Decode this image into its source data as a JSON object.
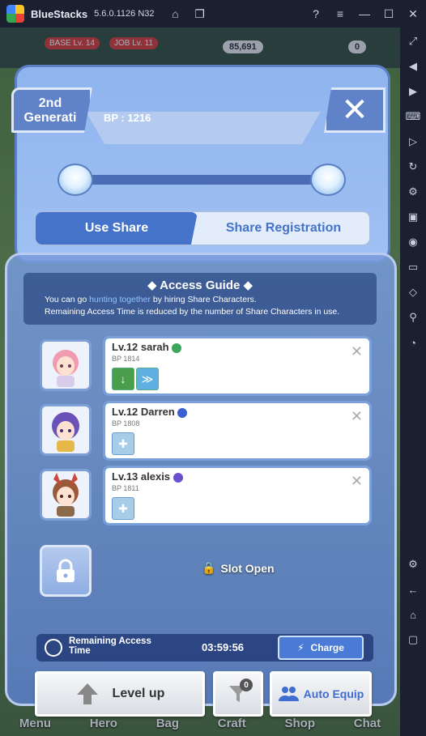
{
  "window": {
    "app_name": "BlueStacks",
    "version": "5.6.0.1126 N32",
    "title_icons": [
      "home-icon",
      "multi-instance-icon"
    ],
    "right_icons": [
      "help-icon",
      "menu-icon",
      "minimize-icon",
      "maximize-icon",
      "close-icon"
    ]
  },
  "sidebar": {
    "icons": [
      "expand-icon",
      "volume-icon",
      "screen-record-icon",
      "keyboard-icon",
      "video-icon",
      "replay-icon",
      "macro-icon",
      "apk-icon",
      "screenshot-icon",
      "folder-icon",
      "eco-mode-icon",
      "location-icon",
      "speed-icon",
      "settings-icon",
      "back-icon",
      "home-icon",
      "recent-apps-icon"
    ]
  },
  "hud": {
    "base_level": "BASE Lv. 14",
    "job_level": "JOB Lv. 11",
    "gold": "85,691",
    "currency2": "0"
  },
  "dialog": {
    "generation_tab": "2nd Generati",
    "bp_fragment": "BP : 1216",
    "tabs": {
      "use_share": "Use Share",
      "share_registration": "Share Registration"
    },
    "access_guide": {
      "title": "Access Guide",
      "line1_prefix": "You can go ",
      "line1_highlight": "hunting together",
      "line1_suffix": " by hiring Share Characters.",
      "line2": "Remaining Access Time is reduced by the number of Share Characters in use."
    },
    "characters": [
      {
        "name": "Lv.12 sarah",
        "bp": "BP 1814",
        "job_color": "#3ba55c"
      },
      {
        "name": "Lv.12 Darren",
        "bp": "BP 1808",
        "job_color": "#3a5fd0"
      },
      {
        "name": "Lv.13 alexis",
        "bp": "BP 1811",
        "job_color": "#6a4fcf"
      }
    ],
    "slot_open": "Slot Open",
    "remaining_time_label": "Remaining Access Time",
    "remaining_time_value": "03:59:56",
    "charge_label": "Charge",
    "level_up_label": "Level up",
    "filter_count": "0",
    "auto_equip_label": "Auto Equip"
  },
  "bottom_nav": [
    "Menu",
    "Hero",
    "Bag",
    "Craft",
    "Shop",
    "Chat"
  ],
  "colors": {
    "accent": "#4473c9",
    "panel": "#8fb4ee",
    "titlebar": "#1a2030"
  }
}
